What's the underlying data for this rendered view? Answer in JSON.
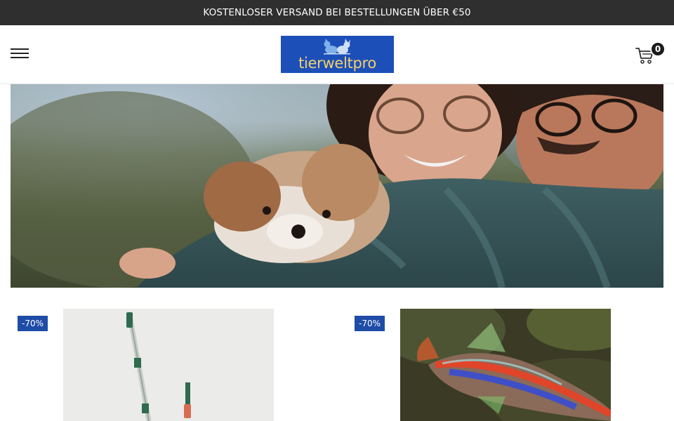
{
  "announcement": {
    "text": "KOSTENLOSER VERSAND BEI BESTELLUNGEN ÜBER €50"
  },
  "header": {
    "logo_text": "tierweltpro",
    "cart_count": "0"
  },
  "icons": {
    "menu": "hamburger-menu-icon",
    "cart": "shopping-cart-icon"
  },
  "colors": {
    "announcement_bg": "#2f2f2f",
    "logo_bg": "#1d4fb8",
    "logo_text": "#f4d06a",
    "sale_badge": "#1e4ca7"
  },
  "products": [
    {
      "badge": "-70%"
    },
    {
      "badge": "-70%"
    }
  ]
}
